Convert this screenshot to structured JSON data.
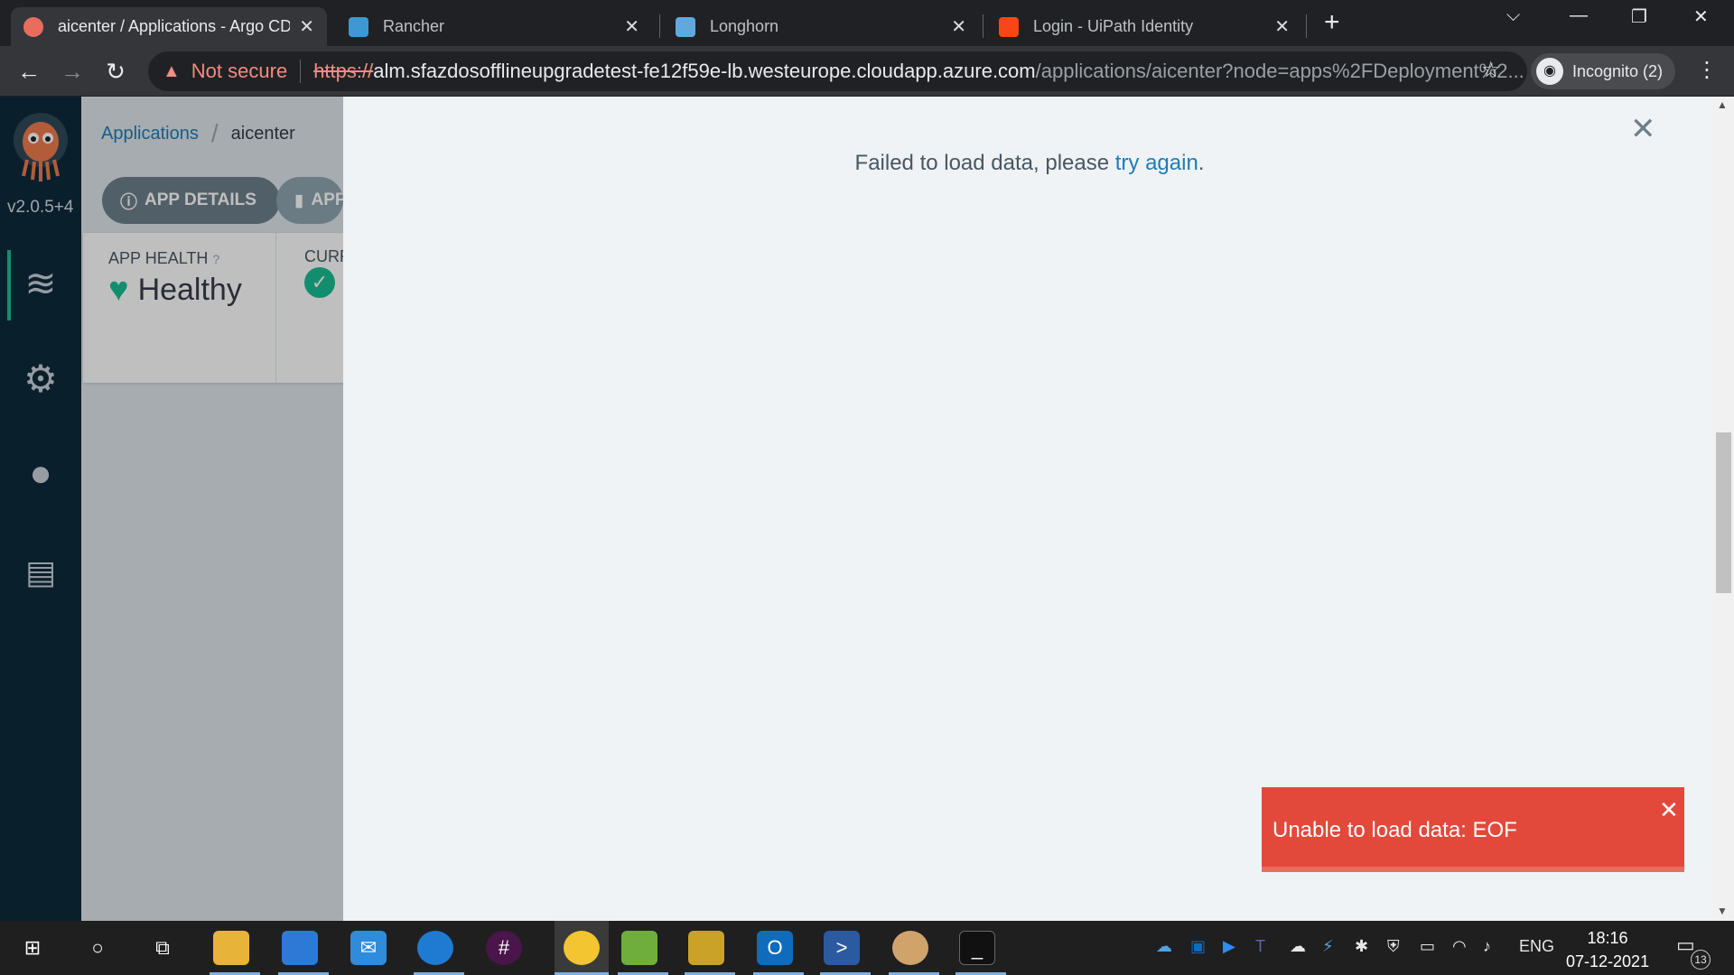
{
  "browser": {
    "tabs": [
      {
        "title": "aicenter / Applications - Argo CD",
        "active": true
      },
      {
        "title": "Rancher",
        "active": false
      },
      {
        "title": "Longhorn",
        "active": false
      },
      {
        "title": "Login - UiPath Identity",
        "active": false
      }
    ],
    "security_label": "Not secure",
    "url_scheme": "https://",
    "url_host": "alm.sfazdosofflineupgradetest-fe12f59e-lb.westeurope.cloudapp.azure.com",
    "url_path": "/applications/aicenter?node=apps%2FDeployment%2...",
    "profile_label": "Incognito (2)"
  },
  "sidebar": {
    "version": "v2.0.5+4"
  },
  "app": {
    "breadcrumb_root": "Applications",
    "breadcrumb_current": "aicenter",
    "app_details_label": "APP DETAILS",
    "app_diff_label": "APP",
    "health_label": "APP HEALTH",
    "health_value": "Healthy",
    "current_sync_label": "CURR"
  },
  "panel": {
    "message_prefix": "Failed to load data, please ",
    "message_link": "try again",
    "message_suffix": "."
  },
  "toast": {
    "message": "Unable to load data: EOF"
  },
  "taskbar": {
    "language": "ENG",
    "time": "18:16",
    "date": "07-12-2021",
    "notification_count": "13"
  },
  "colors": {
    "argo_sidebar": "#0e2a3b",
    "argo_accent": "#18be94",
    "link": "#1c7dba",
    "toast": "#e2493b"
  }
}
